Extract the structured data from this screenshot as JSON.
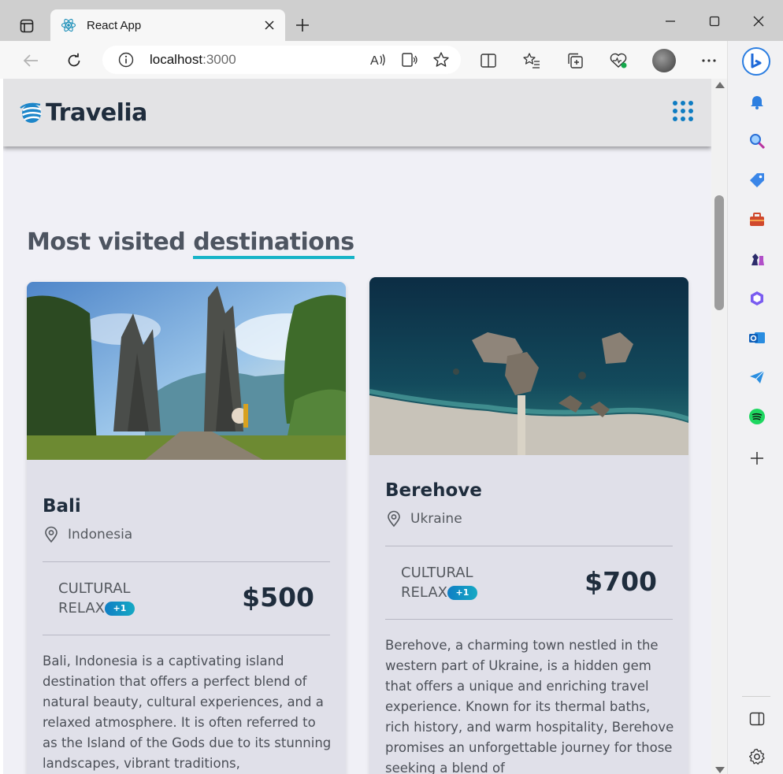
{
  "browser": {
    "tab_title": "React App",
    "url_host": "localhost",
    "url_port": ":3000"
  },
  "site": {
    "brand": "Travelia",
    "section_title_plain": "Most visited ",
    "section_title_highlight": "destinations",
    "accent_color": "#17b4c8"
  },
  "destinations": [
    {
      "name": "Bali",
      "location": "Indonesia",
      "tag_1": "CULTURAL",
      "tag_2": "RELAX",
      "extra_tags": "+1",
      "price": "$500",
      "description": "Bali, Indonesia is a captivating island destination that offers a perfect blend of natural beauty, cultural experiences, and a relaxed atmosphere. It is often referred to as the Island of the Gods due to its stunning landscapes, vibrant traditions,"
    },
    {
      "name": "Berehove",
      "location": "Ukraine",
      "tag_1": "CULTURAL",
      "tag_2": "RELAX",
      "extra_tags": "+1",
      "price": "$700",
      "description": "Berehove, a charming town nestled in the western part of Ukraine, is a hidden gem that offers a unique and enriching travel experience. Known for its thermal baths, rich history, and warm hospitality, Berehove promises an unforgettable journey for those seeking a blend of"
    }
  ]
}
